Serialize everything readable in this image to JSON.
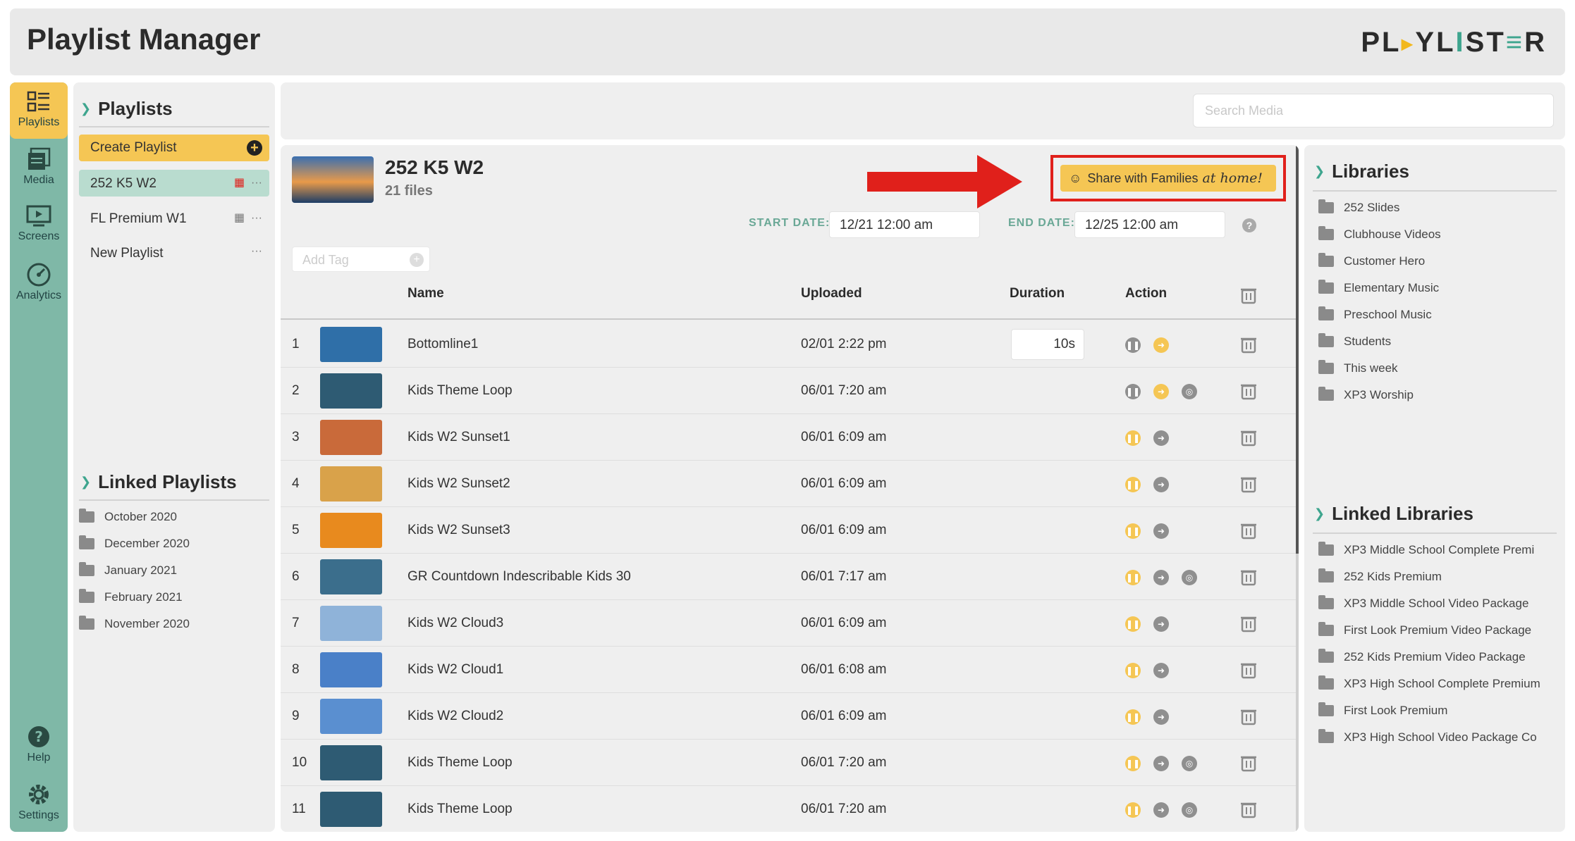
{
  "header": {
    "title": "Playlist Manager",
    "logo_text": "PLYLSTER"
  },
  "rail": {
    "items": [
      {
        "label": "Playlists",
        "icon": "playlists-icon",
        "active": true
      },
      {
        "label": "Media",
        "icon": "media-icon"
      },
      {
        "label": "Screens",
        "icon": "screens-icon"
      },
      {
        "label": "Analytics",
        "icon": "analytics-icon"
      }
    ],
    "bottom_items": [
      {
        "label": "Help",
        "icon": "help-icon"
      },
      {
        "label": "Settings",
        "icon": "settings-icon"
      }
    ]
  },
  "playlists_panel": {
    "title": "Playlists",
    "create_label": "Create Playlist",
    "items": [
      {
        "label": "252 K5 W2",
        "selected": true
      },
      {
        "label": "FL Premium W1"
      },
      {
        "label": "New Playlist"
      }
    ],
    "more_glyph": "···",
    "linked_title": "Linked Playlists",
    "linked_items": [
      "October 2020",
      "December 2020",
      "January 2021",
      "February 2021",
      "November 2020"
    ]
  },
  "search": {
    "placeholder": "Search Media"
  },
  "playlist": {
    "name": "252 K5 W2",
    "files": "21 files",
    "share_label": "Share with Families",
    "share_suffix": "at home!",
    "start_label": "START DATE:",
    "start_value": "12/21 12:00 am",
    "end_label": "END DATE:",
    "end_value": "12/25 12:00 am",
    "help_glyph": "?",
    "tag_placeholder": "Add Tag"
  },
  "table": {
    "headers": {
      "name": "Name",
      "uploaded": "Uploaded",
      "duration": "Duration",
      "action": "Action"
    },
    "rows": [
      {
        "num": "1",
        "name": "Bottomline1",
        "uploaded": "02/01 2:22 pm",
        "duration": "10s",
        "thumb": "#2f6fa8"
      },
      {
        "num": "2",
        "name": "Kids Theme Loop",
        "uploaded": "06/01 7:20 am",
        "thumb": "#2e5b73"
      },
      {
        "num": "3",
        "name": "Kids W2 Sunset1",
        "uploaded": "06/01 6:09 am",
        "thumb": "#c96a3a"
      },
      {
        "num": "4",
        "name": "Kids W2 Sunset2",
        "uploaded": "06/01 6:09 am",
        "thumb": "#d9a24a"
      },
      {
        "num": "5",
        "name": "Kids W2 Sunset3",
        "uploaded": "06/01 6:09 am",
        "thumb": "#e88a1e"
      },
      {
        "num": "6",
        "name": "GR Countdown Indescribable Kids 30",
        "uploaded": "06/01 7:17 am",
        "thumb": "#3b6e8c"
      },
      {
        "num": "7",
        "name": "Kids W2 Cloud3",
        "uploaded": "06/01 6:09 am",
        "thumb": "#8fb3d9"
      },
      {
        "num": "8",
        "name": "Kids W2 Cloud1",
        "uploaded": "06/01 6:08 am",
        "thumb": "#4a80c8"
      },
      {
        "num": "9",
        "name": "Kids W2 Cloud2",
        "uploaded": "06/01 6:09 am",
        "thumb": "#5a8fd0"
      },
      {
        "num": "10",
        "name": "Kids Theme Loop",
        "uploaded": "06/01 7:20 am",
        "thumb": "#2e5b73"
      },
      {
        "num": "11",
        "name": "Kids Theme Loop",
        "uploaded": "06/01 7:20 am",
        "thumb": "#2e5b73"
      }
    ]
  },
  "libraries": {
    "title": "Libraries",
    "items": [
      "252 Slides",
      "Clubhouse Videos",
      "Customer Hero",
      "Elementary Music",
      "Preschool Music",
      "Students",
      "This week",
      "XP3 Worship"
    ],
    "linked_title": "Linked Libraries",
    "linked_items": [
      "XP3 Middle School Complete Premi",
      "252 Kids Premium",
      "XP3 Middle School Video Package",
      "First Look Premium Video Package",
      "252 Kids Premium Video Package",
      "XP3 High School Complete Premium",
      "First Look Premium",
      "XP3 High School Video Package Co"
    ]
  },
  "colors": {
    "accent_yellow": "#f5c654",
    "rail_green": "#7fb8a7",
    "highlight_red": "#e0201b",
    "selected_row": "#b9dccf"
  }
}
